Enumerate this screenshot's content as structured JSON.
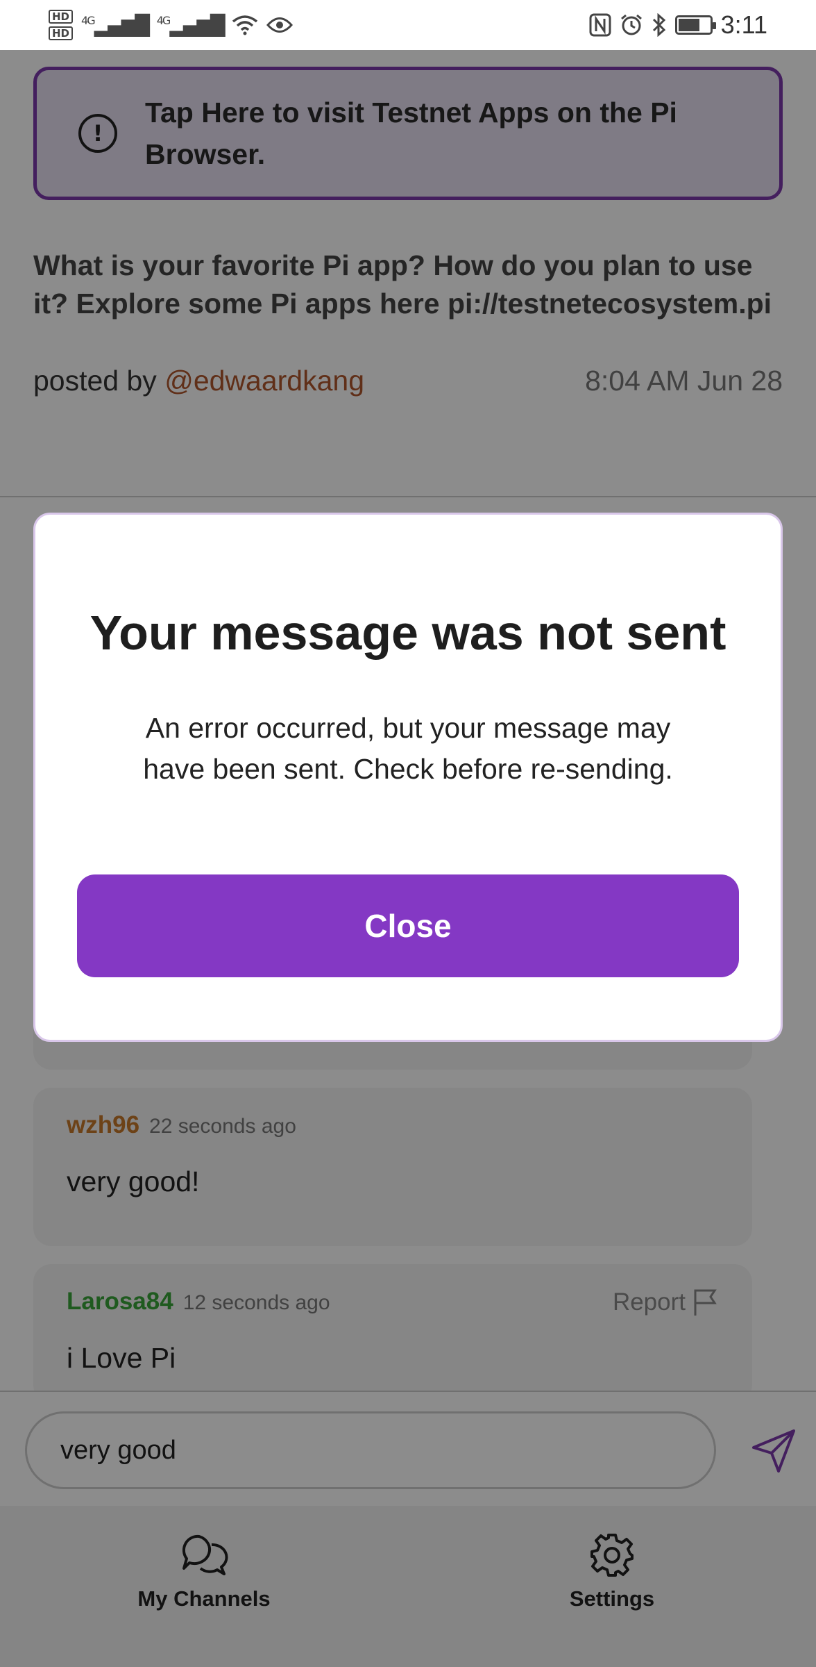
{
  "status_bar": {
    "hd1": "HD",
    "hd2": "HD",
    "net1": "4G",
    "net2": "4G",
    "time": "3:11",
    "battery_level": 0.7,
    "icons": [
      "nfc-icon",
      "alarm-icon",
      "bluetooth-icon",
      "battery-icon",
      "wifi-icon",
      "eye-icon"
    ]
  },
  "banner": {
    "icon": "alert-circle-icon",
    "text": "Tap Here to visit Testnet Apps on the Pi Browser."
  },
  "post": {
    "question": "What is your favorite Pi app? How do you plan to use it? Explore some Pi apps here pi://testnetecosystem.pi",
    "posted_by_label": "posted by",
    "author": "@edwaardkang",
    "timestamp": "8:04 AM Jun 28"
  },
  "messages": [
    {
      "user": "wzh96",
      "user_color": "#c7792a",
      "time": "22 seconds ago",
      "text": "very good!"
    },
    {
      "user": "Larosa84",
      "user_color": "#3aa53a",
      "time": "12 seconds ago",
      "text": "i Love Pi",
      "report_label": "Report"
    }
  ],
  "composer": {
    "value": "very good",
    "send_icon": "send-icon"
  },
  "bottom_nav": [
    {
      "label": "My Channels",
      "icon": "chat-bubbles-icon"
    },
    {
      "label": "Settings",
      "icon": "gear-icon"
    }
  ],
  "dialog": {
    "title": "Your message was not sent",
    "body": "An error occurred, but your message may have been sent. Check before re-sending.",
    "close_label": "Close"
  },
  "colors": {
    "accent": "#8438c4",
    "banner_border": "#7c3aac",
    "author": "#b0562c"
  }
}
